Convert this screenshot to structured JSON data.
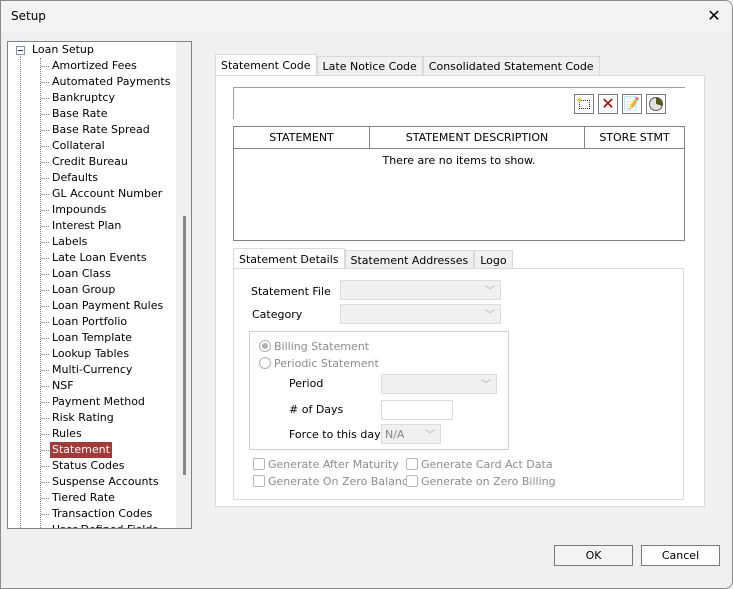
{
  "window": {
    "title": "Setup"
  },
  "tree": {
    "root": "Loan Setup",
    "items": [
      "Amortized Fees",
      "Automated Payments",
      "Bankruptcy",
      "Base Rate",
      "Base Rate Spread",
      "Collateral",
      "Credit Bureau",
      "Defaults",
      "GL Account Number",
      "Impounds",
      "Interest Plan",
      "Labels",
      "Late Loan Events",
      "Loan Class",
      "Loan Group",
      "Loan Payment Rules",
      "Loan Portfolio",
      "Loan Template",
      "Lookup Tables",
      "Multi-Currency",
      "NSF",
      "Payment Method",
      "Risk Rating",
      "Rules",
      "Statement",
      "Status Codes",
      "Suspense Accounts",
      "Tiered Rate",
      "Transaction Codes",
      "User Defined Fields"
    ],
    "selected": "Statement",
    "selected_color": "#a33a3a"
  },
  "top_tabs": [
    "Statement Code",
    "Late Notice Code",
    "Consolidated Statement Code"
  ],
  "toolbar": {
    "icons": [
      "new-icon",
      "delete-icon",
      "edit-icon",
      "refresh-icon"
    ]
  },
  "grid": {
    "columns": [
      "STATEMENT",
      "STATEMENT DESCRIPTION",
      "STORE STMT"
    ],
    "empty_text": "There are no items to show."
  },
  "detail_tabs": [
    "Statement Details",
    "Statement Addresses",
    "Logo"
  ],
  "details": {
    "statement_file_label": "Statement File",
    "category_label": "Category",
    "billing_label": "Billing Statement",
    "periodic_label": "Periodic Statement",
    "period_label": "Period",
    "days_label": "# of Days",
    "force_label": "Force to this day",
    "force_value": "N/A",
    "checks": [
      "Generate After Maturity",
      "Generate Card Act Data",
      "Generate On Zero Balance",
      "Generate on Zero Billing"
    ]
  },
  "buttons": {
    "ok": "OK",
    "cancel": "Cancel"
  }
}
